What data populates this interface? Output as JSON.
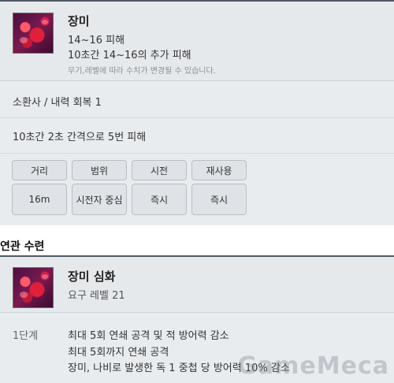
{
  "skill": {
    "name": "장미",
    "damage": "14~16 피해",
    "dot": "10초간 14~16의 추가 피해",
    "note": "무기,레벨에 따라 수치가 변경될 수 있습니다.",
    "icon": "rose-icon"
  },
  "cost": "소환사 / 내력 회복 1",
  "effect": "10초간 2초 간격으로 5번 피해",
  "stats": {
    "headers": [
      "거리",
      "범위",
      "시전",
      "재사용"
    ],
    "values": [
      "16m",
      "시전자 중심",
      "즉시",
      "즉시"
    ]
  },
  "related": {
    "section_title": "연관 수련",
    "name": "장미 심화",
    "requirement": "요구 레벨 21",
    "level": "1단계",
    "lines": [
      "최대 5회 연쇄 공격 및 적 방어력 감소",
      "최대 5회까지 연쇄 공격",
      "장미, 나비로 발생한 독 1 중첩 당 방어력 10% 감소"
    ],
    "icon": "rose-icon"
  },
  "watermark": "GameMeca"
}
